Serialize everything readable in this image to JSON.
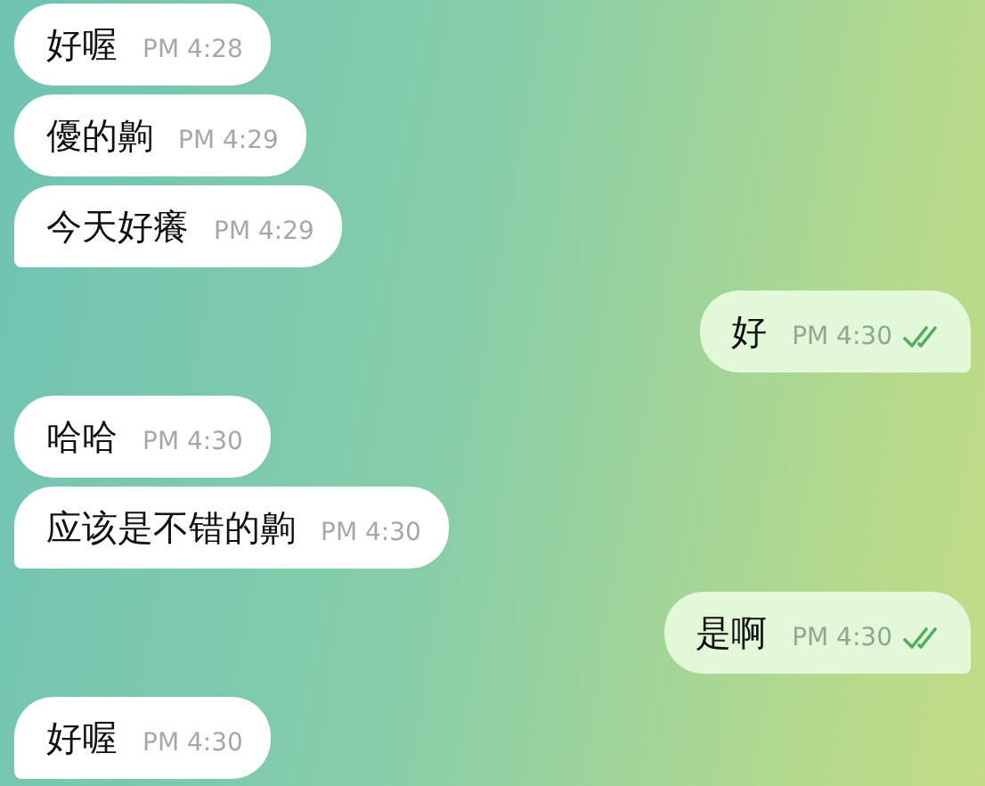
{
  "groups": [
    {
      "kind": "incoming",
      "messages": [
        {
          "text": "好喔",
          "time": "PM 4:28"
        },
        {
          "text": "優的齁",
          "time": "PM 4:29"
        },
        {
          "text": "今天好癢",
          "time": "PM 4:29"
        }
      ]
    },
    {
      "kind": "outgoing",
      "messages": [
        {
          "text": "好",
          "time": "PM 4:30",
          "read": true
        }
      ]
    },
    {
      "kind": "incoming",
      "messages": [
        {
          "text": "哈哈",
          "time": "PM 4:30"
        },
        {
          "text": "应该是不错的齁",
          "time": "PM 4:30"
        }
      ]
    },
    {
      "kind": "outgoing",
      "messages": [
        {
          "text": "是啊",
          "time": "PM 4:30",
          "read": true
        }
      ]
    },
    {
      "kind": "incoming",
      "messages": [
        {
          "text": "好喔",
          "time": "PM 4:30"
        }
      ]
    }
  ]
}
